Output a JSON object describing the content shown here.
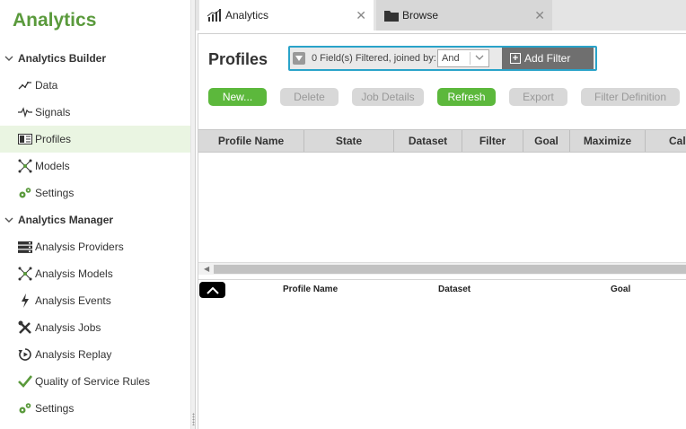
{
  "app_title": "Analytics",
  "sidebar": {
    "groups": [
      {
        "label": "Analytics Builder"
      },
      {
        "label": "Analytics Manager"
      }
    ],
    "builder_items": [
      {
        "label": "Data",
        "icon": "line-chart-icon"
      },
      {
        "label": "Signals",
        "icon": "signal-wave-icon"
      },
      {
        "label": "Profiles",
        "icon": "profile-card-icon",
        "active": true
      },
      {
        "label": "Models",
        "icon": "network-nodes-icon"
      },
      {
        "label": "Settings",
        "icon": "gears-icon"
      }
    ],
    "manager_items": [
      {
        "label": "Analysis Providers",
        "icon": "server-icon"
      },
      {
        "label": "Analysis Models",
        "icon": "network-nodes-icon"
      },
      {
        "label": "Analysis Events",
        "icon": "lightning-icon"
      },
      {
        "label": "Analysis Jobs",
        "icon": "tools-icon"
      },
      {
        "label": "Analysis Replay",
        "icon": "replay-icon"
      },
      {
        "label": "Quality of Service Rules",
        "icon": "checkmark-icon"
      },
      {
        "label": "Settings",
        "icon": "gears-icon"
      }
    ]
  },
  "tabs": [
    {
      "label": "Analytics",
      "icon": "bar-chart-icon",
      "active": true
    },
    {
      "label": "Browse",
      "icon": "folder-icon",
      "active": false
    }
  ],
  "main": {
    "title": "Profiles",
    "filter": {
      "status_text": "0 Field(s) Filtered, joined by:",
      "join_value": "And",
      "add_label": "Add Filter"
    },
    "toolbar": {
      "new": "New...",
      "delete": "Delete",
      "job_details": "Job Details",
      "refresh": "Refresh",
      "export": "Export",
      "filter_definition": "Filter Definition"
    },
    "grid_columns": [
      "Profile Name",
      "State",
      "Dataset",
      "Filter",
      "Goal",
      "Maximize",
      "Calc"
    ],
    "detail_columns": [
      "Profile Name",
      "Dataset",
      "Goal"
    ]
  },
  "colors": {
    "brand_green": "#5a9a3c",
    "button_green": "#5cb83c",
    "filter_border": "#29a3c9",
    "active_row": "#eaf5e2"
  }
}
